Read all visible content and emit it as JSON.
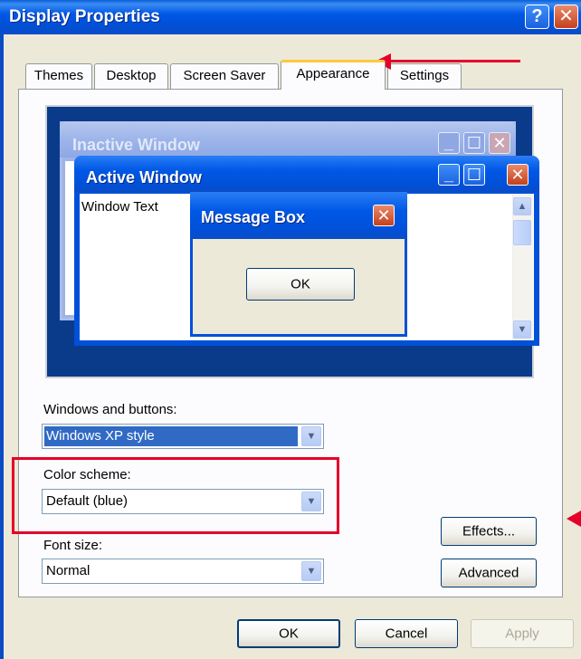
{
  "window": {
    "title": "Display Properties",
    "help_glyph": "?",
    "close_glyph": "✕"
  },
  "tabs": [
    {
      "label": "Themes",
      "active": false
    },
    {
      "label": "Desktop",
      "active": false
    },
    {
      "label": "Screen Saver",
      "active": false
    },
    {
      "label": "Appearance",
      "active": true
    },
    {
      "label": "Settings",
      "active": false
    }
  ],
  "preview": {
    "inactive_title": "Inactive Window",
    "active_title": "Active Window",
    "window_text": "Window Text",
    "message_box_title": "Message Box",
    "message_box_ok": "OK"
  },
  "form": {
    "windows_buttons_label": "Windows and buttons:",
    "windows_buttons_value": "Windows XP style",
    "color_scheme_label": "Color scheme:",
    "color_scheme_value": "Default (blue)",
    "font_size_label": "Font size:",
    "font_size_value": "Normal",
    "effects_button": "Effects...",
    "advanced_button": "Advanced"
  },
  "footer": {
    "ok": "OK",
    "cancel": "Cancel",
    "apply": "Apply"
  },
  "colors": {
    "annotation": "#e5002a",
    "titlebar": "#0058e6",
    "dialog_bg": "#ece9d8"
  }
}
